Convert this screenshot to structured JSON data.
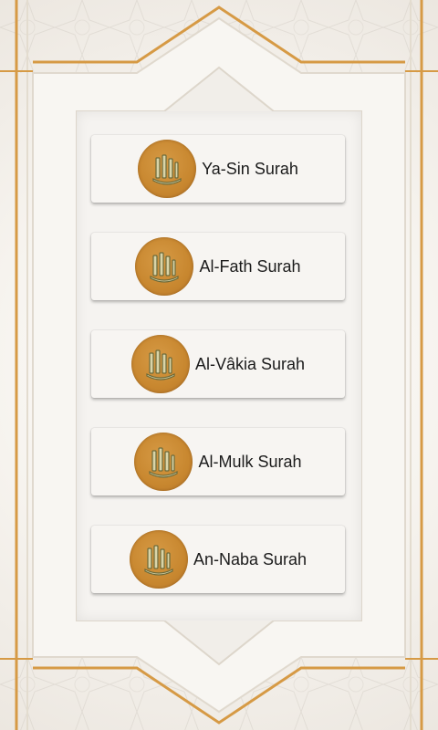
{
  "surah_list": [
    {
      "label": "Ya-Sin Surah"
    },
    {
      "label": "Al-Fath Surah"
    },
    {
      "label": "Al-Vâkia Surah"
    },
    {
      "label": "Al-Mulk Surah"
    },
    {
      "label": "An-Naba Surah"
    }
  ],
  "colors": {
    "gold_frame": "#d69a45",
    "badge": "#c8872f",
    "card": "#f7f5f2",
    "background": "#f4f1ec"
  },
  "icons": {
    "surah_badge": "allah-calligraphy-icon"
  }
}
